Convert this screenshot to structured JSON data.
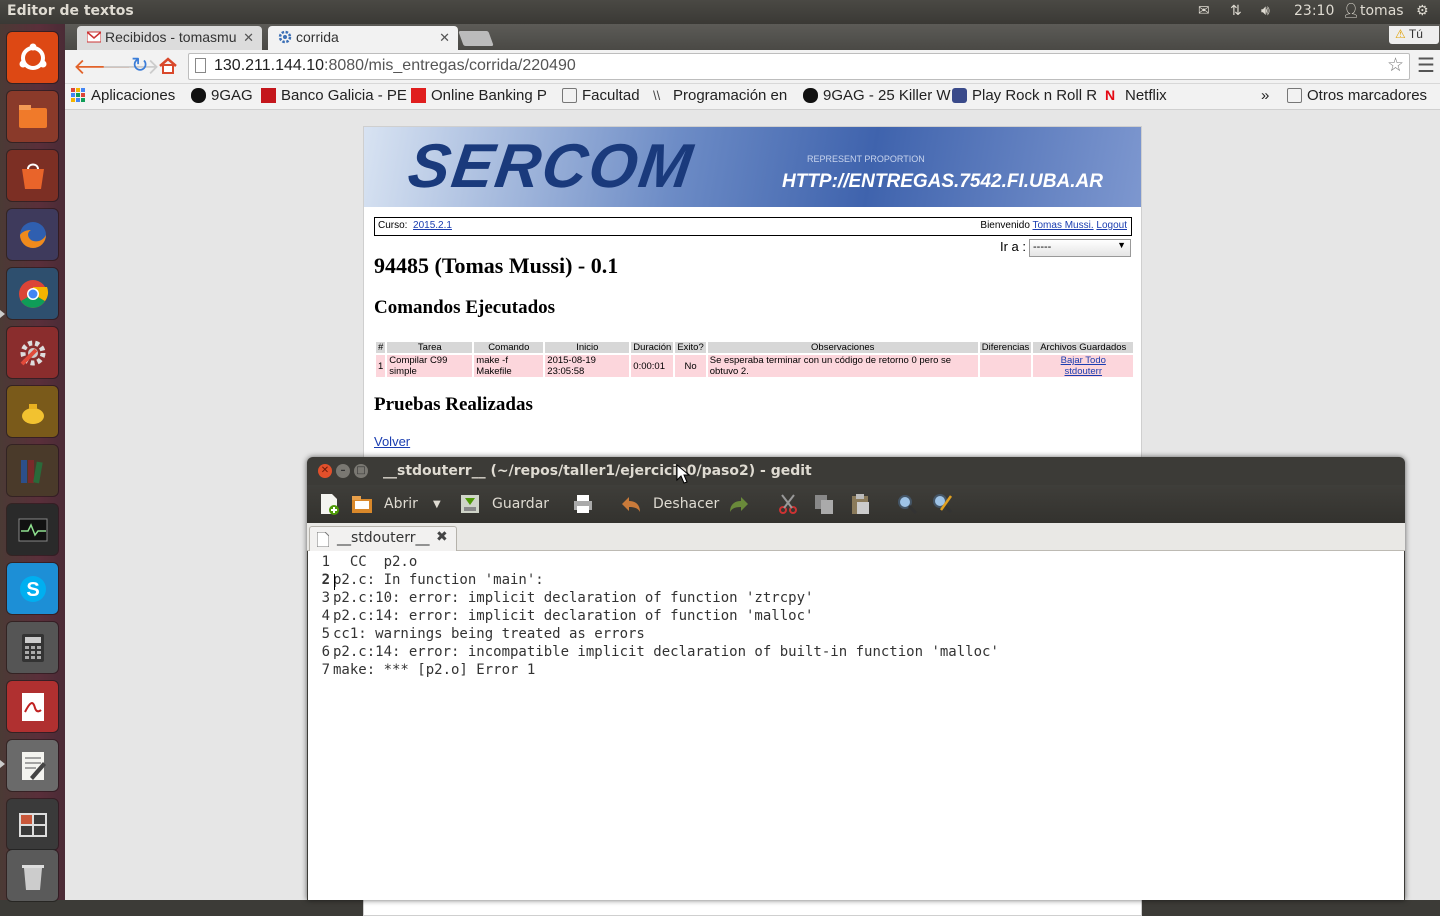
{
  "topbar": {
    "app_title": "Editor de textos",
    "time": "23:10",
    "user": "tomas"
  },
  "browser": {
    "tabs": [
      {
        "label": "Recibidos - tomasmu"
      },
      {
        "label": "corrida"
      }
    ],
    "profile_label": "Tú",
    "url_host": "130.211.144.10",
    "url_rest": ":8080/mis_entregas/corrida/220490",
    "bookmarks": [
      {
        "label": "Aplicaciones"
      },
      {
        "label": "9GAG"
      },
      {
        "label": "Banco Galicia - PE"
      },
      {
        "label": "Online Banking P"
      },
      {
        "label": "Facultad"
      },
      {
        "label": "Programación en"
      },
      {
        "label": "9GAG - 25 Killer W"
      },
      {
        "label": "Play Rock n Roll R"
      },
      {
        "label": "Netflix"
      }
    ],
    "more_label": "»",
    "other_bookmarks": "Otros marcadores"
  },
  "page": {
    "banner_logo": "SERCOM",
    "banner_url": "HTTP://ENTREGAS.7542.FI.UBA.AR",
    "banner_small": "REPRESENT PROPORTION",
    "curso_label": "Curso:",
    "curso_value": "2015.2.1",
    "welcome": "Bienvenido",
    "user_link": "Tomas Mussi.",
    "logout": "Logout",
    "ira_label": "Ir a :",
    "ira_value": "-----",
    "heading": "94485 (Tomas Mussi) - 0.1",
    "commands_heading": "Comandos Ejecutados",
    "table_headers": [
      "#",
      "Tarea",
      "Comando",
      "Inicio",
      "Duración",
      "Exito?",
      "Observaciones",
      "Diferencias",
      "Archivos Guardados"
    ],
    "row": {
      "num": "1",
      "tarea_1": "Compilar C99",
      "tarea_2": "simple",
      "comando_1": "make -f",
      "comando_2": "Makefile",
      "inicio_1": "2015-08-19",
      "inicio_2": "23:05:58",
      "duracion": "0:00:01",
      "exito": "No",
      "obs_1": "Se esperaba terminar con un código de retorno 0 pero se",
      "obs_2": "obtuvo 2.",
      "diferencias": "",
      "archivo_1": "Bajar Todo",
      "archivo_2": "stdouterr"
    },
    "tests_heading": "Pruebas Realizadas",
    "back_link": "Volver"
  },
  "gedit": {
    "title": "__stdouterr__ (~/repos/taller1/ejercicio0/paso2) - gedit",
    "open_label": "Abrir",
    "save_label": "Guardar",
    "undo_label": "Deshacer",
    "tab_label": "__stdouterr__",
    "lines": [
      {
        "n": "1",
        "text": "  CC  p2.o"
      },
      {
        "n": "2",
        "text": "p2.c: In function 'main':"
      },
      {
        "n": "3",
        "text": "p2.c:10: error: implicit declaration of function 'ztrcpy'"
      },
      {
        "n": "4",
        "text": "p2.c:14: error: implicit declaration of function 'malloc'"
      },
      {
        "n": "5",
        "text": "cc1: warnings being treated as errors"
      },
      {
        "n": "6",
        "text": "p2.c:14: error: incompatible implicit declaration of built-in function 'malloc'"
      },
      {
        "n": "7",
        "text": "make: *** [p2.o] Error 1"
      }
    ]
  },
  "colors": {
    "panel": "#3c3b37",
    "launcher": "#5a2f3a",
    "ubuntu_orange": "#dd4814",
    "row_pink": "#fcd6dc",
    "link_blue": "#1a3db0"
  },
  "icons": [
    "ubuntu-logo-icon",
    "files-icon",
    "software-center-icon",
    "firefox-icon",
    "chrome-icon",
    "settings-icon",
    "teapot-icon",
    "books-icon",
    "system-monitor-icon",
    "skype-icon",
    "calculator-icon",
    "pdf-reader-icon",
    "text-editor-icon",
    "workspaces-icon",
    "trash-icon"
  ]
}
